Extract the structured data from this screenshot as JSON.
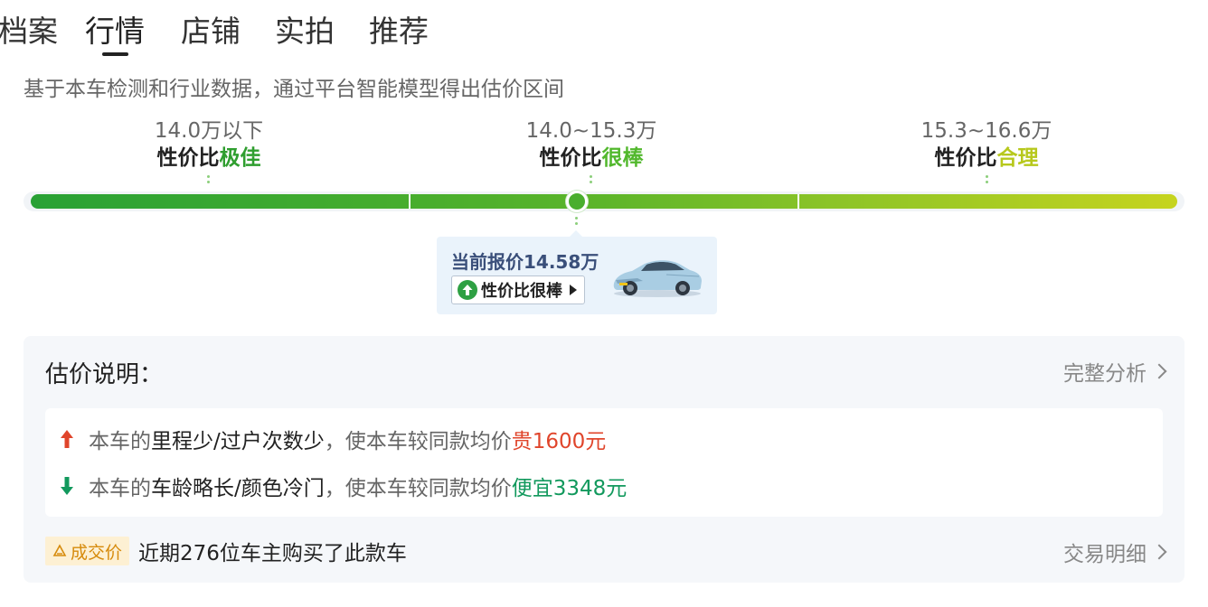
{
  "tabs": [
    {
      "label": "档案",
      "active": false
    },
    {
      "label": "行情",
      "active": true
    },
    {
      "label": "店铺",
      "active": false
    },
    {
      "label": "实拍",
      "active": false
    },
    {
      "label": "推荐",
      "active": false
    }
  ],
  "subtitle": "基于本车检测和行业数据，通过平台智能模型得出估价区间",
  "ranges": [
    {
      "price": "14.0万以下",
      "grade_prefix": "性价比",
      "grade": "极佳",
      "grade_color": "#2f9e2f"
    },
    {
      "price": "14.0~15.3万",
      "grade_prefix": "性价比",
      "grade": "很棒",
      "grade_color": "#52b82d"
    },
    {
      "price": "15.3~16.6万",
      "grade_prefix": "性价比",
      "grade": "合理",
      "grade_color": "#b7c81c"
    }
  ],
  "current": {
    "price_label": "当前报价14.58万",
    "price_value": 14.58,
    "badge": "性价比很棒"
  },
  "explain": {
    "title": "估价说明：",
    "link": "完整分析",
    "reasons": [
      {
        "direction": "up",
        "prefix": "本车的",
        "factors": "里程少/过户次数少",
        "middle": "，使本车较同款均价",
        "result": "贵1600元"
      },
      {
        "direction": "down",
        "prefix": "本车的",
        "factors": "车龄略长/颜色冷门",
        "middle": "，使本车较同款均价",
        "result": "便宜3348元"
      }
    ]
  },
  "deal": {
    "tag": "成交价",
    "text": "近期276位车主购买了此款车",
    "link": "交易明细"
  },
  "colors": {
    "up": "#e0452b",
    "down": "#12995d",
    "accent_green": "#49ae2d"
  }
}
